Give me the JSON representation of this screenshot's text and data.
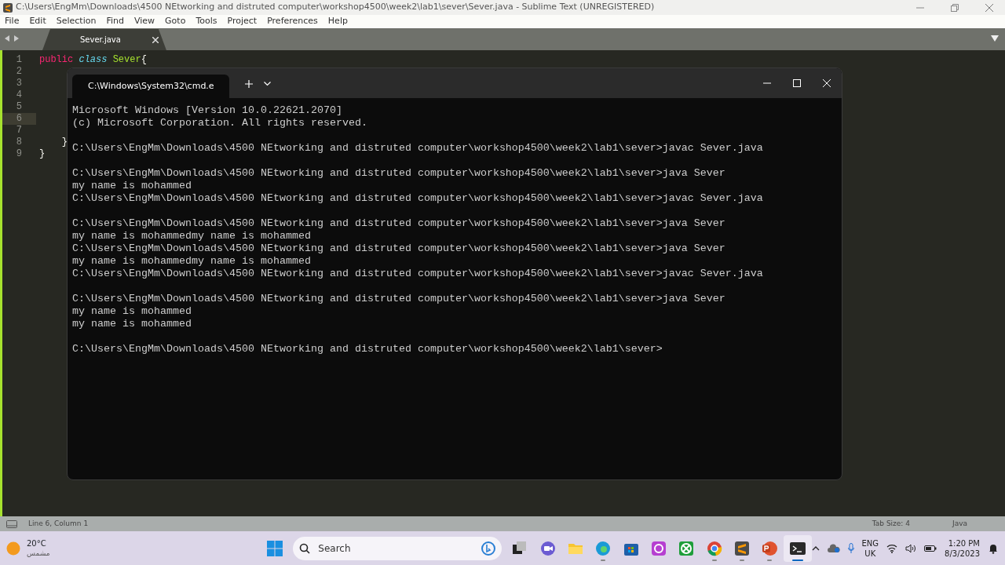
{
  "window": {
    "title": "C:\\Users\\EngMm\\Downloads\\4500 NEtworking and distruted computer\\workshop4500\\week2\\lab1\\sever\\Sever.java - Sublime Text (UNREGISTERED)"
  },
  "menu": [
    "File",
    "Edit",
    "Selection",
    "Find",
    "View",
    "Goto",
    "Tools",
    "Project",
    "Preferences",
    "Help"
  ],
  "tabs": [
    {
      "label": "Sever.java",
      "selected": true
    }
  ],
  "editor": {
    "lines": [
      {
        "number": "1",
        "code": "public class Sever{",
        "current": false
      },
      {
        "number": "2",
        "current": false
      },
      {
        "number": "3",
        "current": false
      },
      {
        "number": "4",
        "current": false
      },
      {
        "number": "5",
        "current": false
      },
      {
        "number": "6",
        "current": true
      },
      {
        "number": "7",
        "current": false
      },
      {
        "number": "8",
        "code": "    }",
        "current": false
      },
      {
        "number": "9",
        "code": "}",
        "current": false
      }
    ]
  },
  "terminal": {
    "tab_title": "C:\\Windows\\System32\\cmd.e",
    "blocks": [
      {
        "lines": [
          "Microsoft Windows [Version 10.0.22621.2070]",
          "(c) Microsoft Corporation. All rights reserved."
        ]
      },
      {
        "lines": [
          "C:\\Users\\EngMm\\Downloads\\4500 NEtworking and distruted computer\\workshop4500\\week2\\lab1\\sever>javac Sever.java"
        ]
      },
      {
        "lines": [
          "C:\\Users\\EngMm\\Downloads\\4500 NEtworking and distruted computer\\workshop4500\\week2\\lab1\\sever>java Sever",
          "my name is mohammed",
          "C:\\Users\\EngMm\\Downloads\\4500 NEtworking and distruted computer\\workshop4500\\week2\\lab1\\sever>javac Sever.java"
        ]
      },
      {
        "lines": [
          "C:\\Users\\EngMm\\Downloads\\4500 NEtworking and distruted computer\\workshop4500\\week2\\lab1\\sever>java Sever",
          "my name is mohammedmy name is mohammed",
          "C:\\Users\\EngMm\\Downloads\\4500 NEtworking and distruted computer\\workshop4500\\week2\\lab1\\sever>java Sever",
          "my name is mohammedmy name is mohammed",
          "C:\\Users\\EngMm\\Downloads\\4500 NEtworking and distruted computer\\workshop4500\\week2\\lab1\\sever>javac Sever.java"
        ]
      },
      {
        "lines": [
          "C:\\Users\\EngMm\\Downloads\\4500 NEtworking and distruted computer\\workshop4500\\week2\\lab1\\sever>java Sever",
          "my name is mohammed",
          "my name is mohammed"
        ]
      },
      {
        "lines": [
          "C:\\Users\\EngMm\\Downloads\\4500 NEtworking and distruted computer\\workshop4500\\week2\\lab1\\sever>"
        ]
      }
    ]
  },
  "status_bar": {
    "position": "Line 6, Column 1",
    "tab_size": "Tab Size: 4",
    "syntax": "Java"
  },
  "taskbar": {
    "weather": {
      "temperature": "20°C",
      "condition": "مشمس"
    },
    "search": {
      "placeholder": "Search"
    },
    "apps": [
      {
        "kind": "taskview",
        "active": false,
        "running": false
      },
      {
        "kind": "chat",
        "active": false,
        "running": false
      },
      {
        "kind": "folder",
        "active": false,
        "running": false
      },
      {
        "kind": "browser",
        "active": false,
        "running": true
      },
      {
        "kind": "store",
        "active": false,
        "running": false
      },
      {
        "kind": "photo",
        "active": false,
        "running": false
      },
      {
        "kind": "game",
        "active": false,
        "running": false
      },
      {
        "kind": "chrome",
        "active": false,
        "running": true
      },
      {
        "kind": "sublime",
        "active": false,
        "running": true
      },
      {
        "kind": "slides",
        "active": false,
        "running": true
      },
      {
        "kind": "terminal",
        "active": true,
        "running": true
      }
    ],
    "language": {
      "code": "ENG",
      "region": "UK"
    },
    "time": "1:20 PM",
    "date": "8/3/2023"
  }
}
